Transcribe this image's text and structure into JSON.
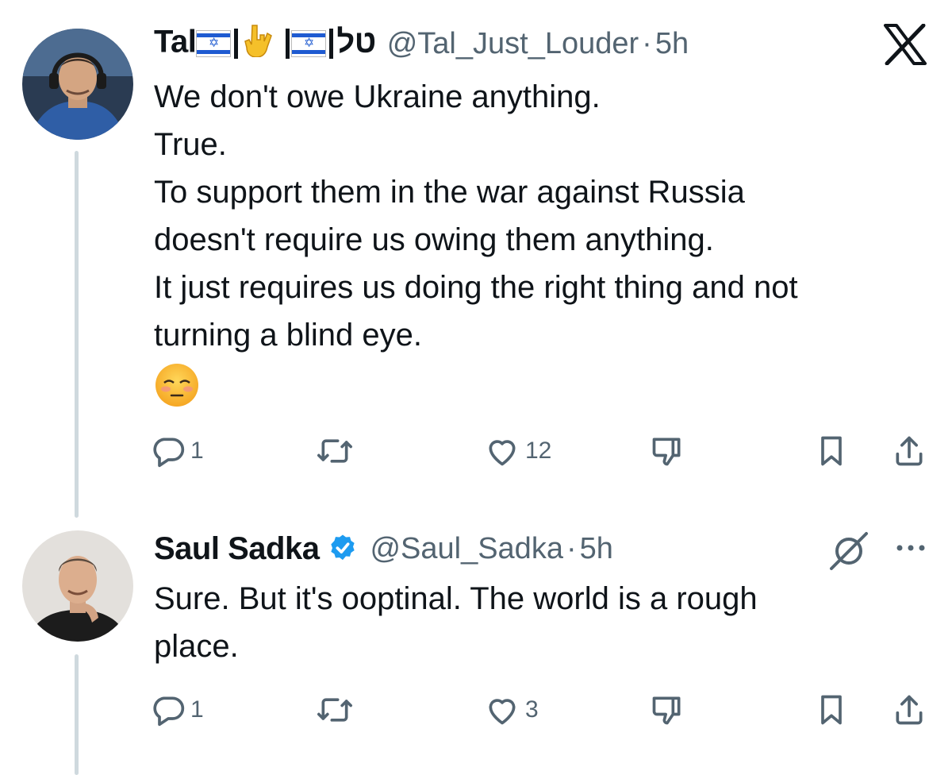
{
  "tweets": [
    {
      "display_name_prefix": "Tal",
      "display_name_suffix": "טל",
      "handle": "@Tal_Just_Louder",
      "separator": "·",
      "time": "5h",
      "lines": [
        "We don't owe Ukraine anything.",
        "True.",
        "To support them in the war against Russia",
        "doesn't require us owing them anything.",
        "It just requires us doing the right thing and not",
        "turning a blind eye."
      ],
      "reply_count": "1",
      "like_count": "12"
    },
    {
      "display_name": "Saul Sadka",
      "handle": "@Saul_Sadka",
      "separator": "·",
      "time": "5h",
      "lines": [
        "Sure. But it's ooptinal. The world is a rough",
        "place."
      ],
      "reply_count": "1",
      "like_count": "3"
    }
  ],
  "icons": {
    "top_right": "x-logo-icon",
    "reply": "reply-icon",
    "retweet": "retweet-icon",
    "like": "heart-icon",
    "dislike": "dislike-icon",
    "bookmark": "bookmark-icon",
    "share": "share-icon",
    "more": "more-icon",
    "grok": "grok-icon",
    "verified": "verified-badge-icon"
  },
  "colors": {
    "text": "#0f1419",
    "muted": "#536471",
    "verified": "#1d9bf0",
    "thread": "#cfd9de"
  }
}
